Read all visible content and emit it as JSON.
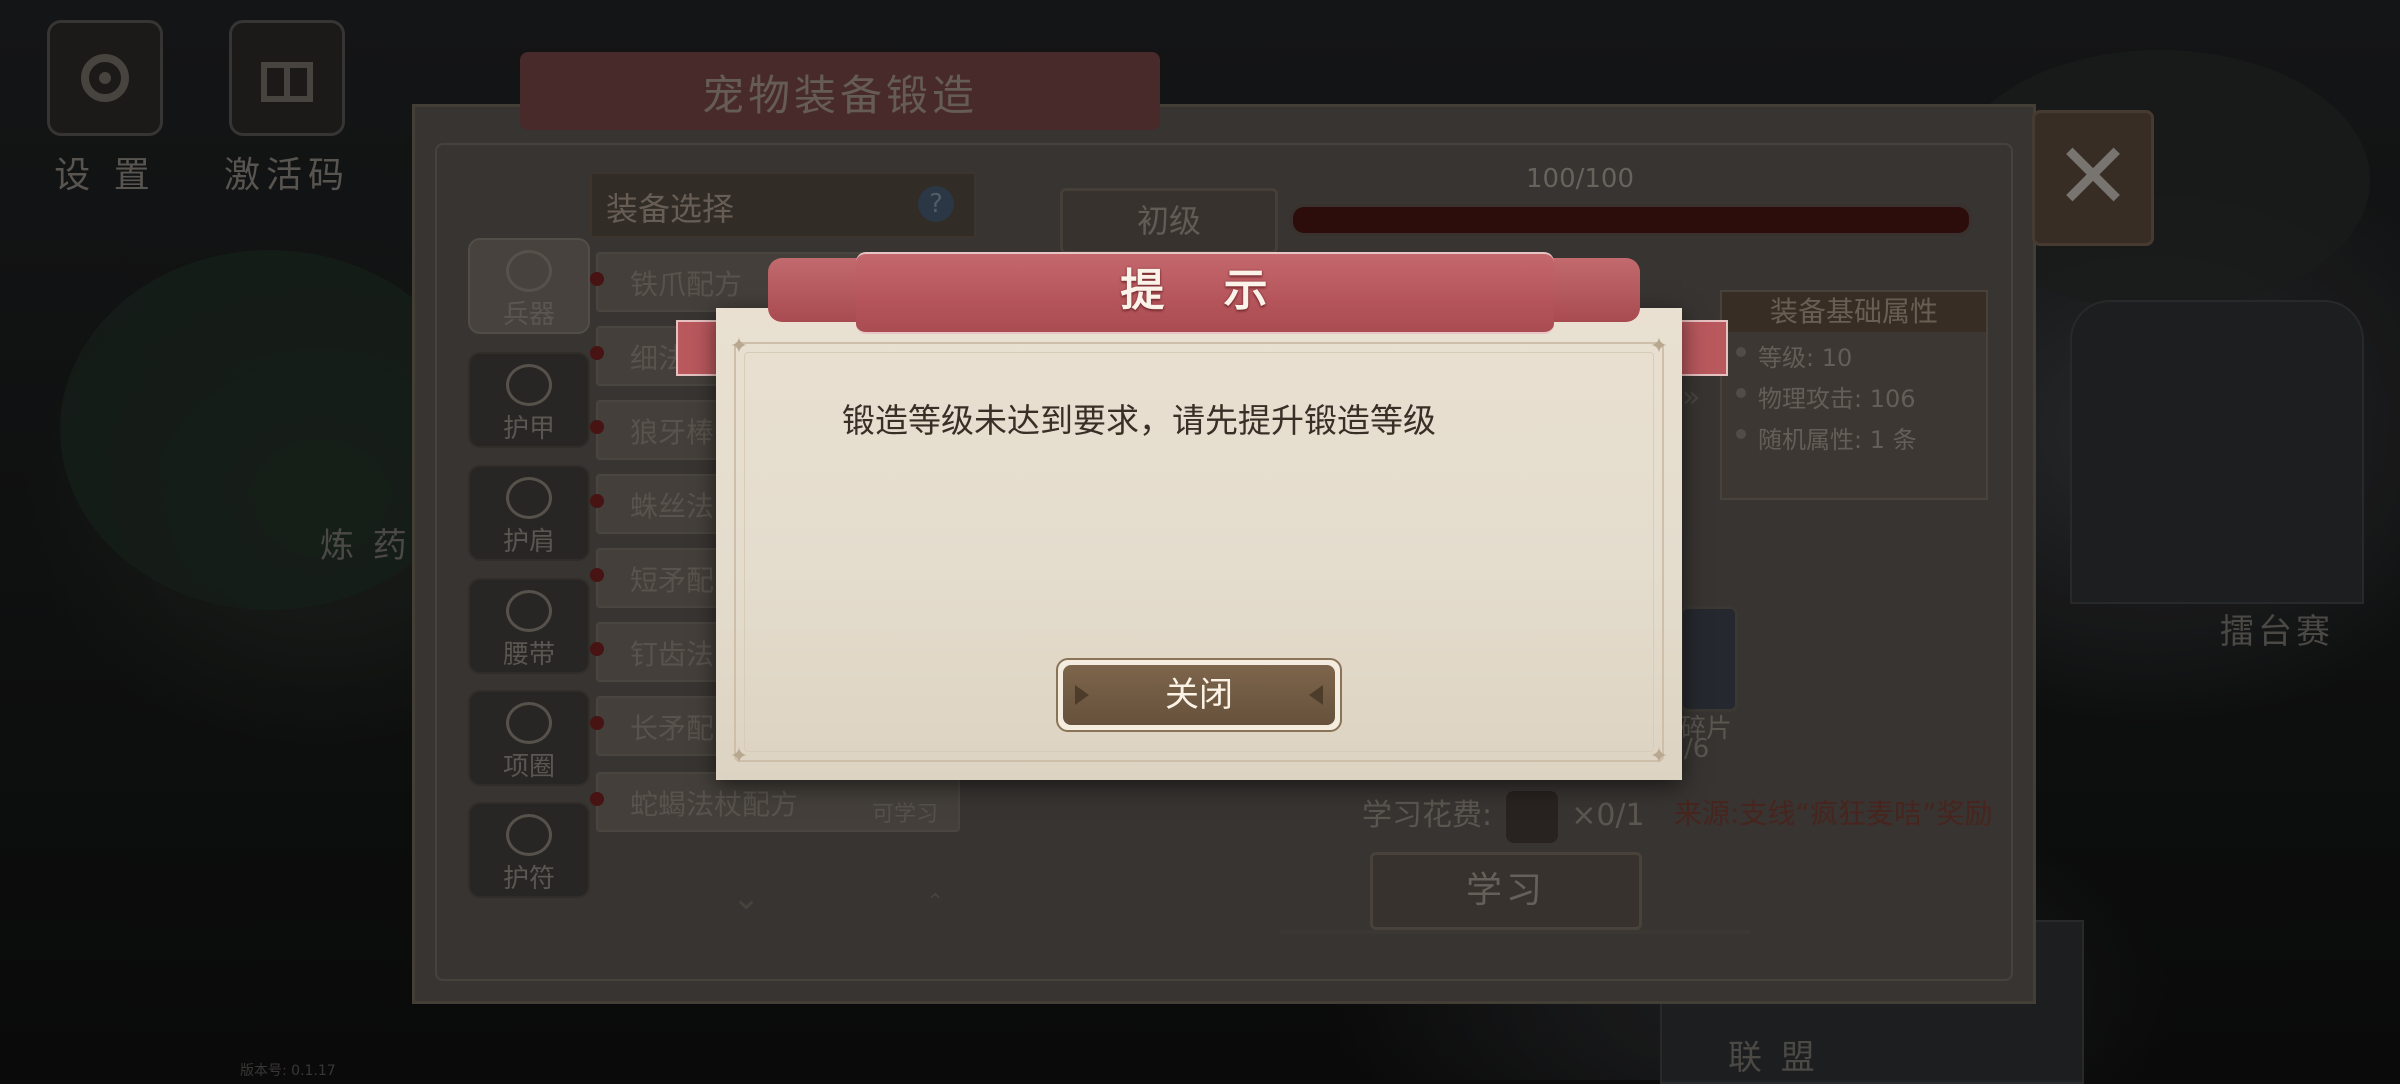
{
  "top_buttons": [
    {
      "label": "设 置"
    },
    {
      "label": "激活码"
    }
  ],
  "map_labels": {
    "alchemy": "炼 药",
    "arena": "擂台赛",
    "alliance": "联 盟"
  },
  "version": "版本号: 0.1.17",
  "forge": {
    "title": "宠物装备锻造",
    "categories": [
      "兵器",
      "护甲",
      "护肩",
      "腰带",
      "项圈",
      "护符"
    ],
    "list_header": "装备选择",
    "help_icon": "?",
    "recipes": [
      {
        "name": "铁爪配方",
        "status": ""
      },
      {
        "name": "细法",
        "status": ""
      },
      {
        "name": "狼牙棒",
        "status": ""
      },
      {
        "name": "蛛丝法",
        "status": ""
      },
      {
        "name": "短矛配",
        "status": ""
      },
      {
        "name": "钉齿法",
        "status": ""
      },
      {
        "name": "长矛配",
        "status": ""
      },
      {
        "name": "蛇蝎法杖配方",
        "status": "可学习"
      }
    ],
    "level": "初级",
    "progress_text": "100/100",
    "progress_fraction": 1.0,
    "attributes": {
      "title": "装备基础属性",
      "rows": [
        "等级: 10",
        "物理攻击: 106",
        "随机属性: 1 条"
      ]
    },
    "material": {
      "label": "碎片",
      "count": "/6"
    },
    "cost_label": "学习花费:",
    "cost_qty": "×0/1",
    "source": "来源:支线“疯狂麦咭”奖励",
    "learn_button": "学习"
  },
  "dialog": {
    "title": "提 示",
    "message": "锻造等级未达到要求，请先提升锻造等级",
    "close_button": "关闭"
  },
  "colors": {
    "ribbon": "#b5555b",
    "paper": "#e4dccd",
    "button": "#66513c",
    "text_dark": "#3a2f27"
  }
}
